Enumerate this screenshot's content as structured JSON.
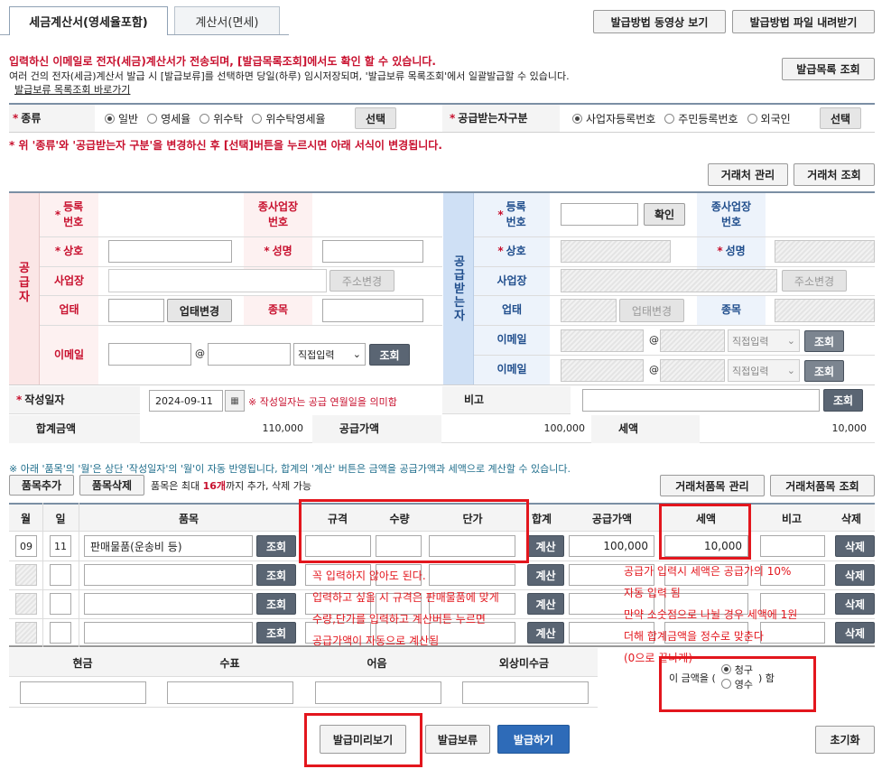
{
  "tabs": [
    {
      "label": "세금계산서(영세율포함)"
    },
    {
      "label": "계산서(면세)"
    }
  ],
  "top_buttons": {
    "video": "발급방법 동영상 보기",
    "download": "발급방법 파일 내려받기",
    "list": "발급목록 조회"
  },
  "notice": {
    "line1": "입력하신 이메일로 전자(세금)계산서가 전송되며, [발급목록조회]에서도 확인 할 수 있습니다.",
    "line2": "여러 건의 전자(세금)계산서 발급 시 [발급보류]를 선택하면 당일(하루) 임시저장되며, '발급보류 목록조회'에서 일괄발급할 수 있습니다.",
    "link": "발급보류 목록조회 바로가기"
  },
  "type_row": {
    "label": "종류",
    "options": [
      "일반",
      "영세율",
      "위수탁",
      "위수탁영세율"
    ],
    "select": "선택",
    "recv_label": "공급받는자구분",
    "recv_options": [
      "사업자등록번호",
      "주민등록번호",
      "외국인"
    ],
    "recv_select": "선택"
  },
  "warning": "* 위 '종류'와 '공급받는자 구분'을 변경하신 후 [선택]버튼을 누르시면 아래 서식이 변경됩니다.",
  "partner_buttons": {
    "manage": "거래처 관리",
    "search": "거래처 조회"
  },
  "supplier": {
    "title": "공급자",
    "reg_no": "등록\n번호",
    "sub_biz": "종사업장\n번호",
    "name": "상호",
    "ceo": "성명",
    "address": "사업장",
    "addr_btn": "주소변경",
    "biz_type": "업태",
    "biz_btn": "업태변경",
    "item": "종목",
    "email": "이메일",
    "at": "@",
    "email_select": "직접입력",
    "search": "조회"
  },
  "receiver": {
    "title": "공급받는자",
    "reg_no": "등록\n번호",
    "confirm": "확인",
    "sub_biz": "종사업장\n번호",
    "name": "상호",
    "ceo": "성명",
    "address": "사업장",
    "addr_btn": "주소변경",
    "biz_type": "업태",
    "biz_btn": "업태변경",
    "item": "종목",
    "email": "이메일",
    "at": "@",
    "email_select": "직접입력",
    "search": "조회"
  },
  "date_row": {
    "label": "작성일자",
    "date": "2024-09-11",
    "note": "※ 작성일자는 공급 연월일을 의미함",
    "remark": "비고",
    "search": "조회"
  },
  "totals": {
    "total_label": "합계금액",
    "total": "110,000",
    "supply_label": "공급가액",
    "supply": "100,000",
    "tax_label": "세액",
    "tax": "10,000"
  },
  "items_notice": "※ 아래 '품목'의 '월'은 상단 '작성일자'의 '월'이 자동 반영됩니다, 합계의 '계산' 버튼은 금액을 공급가액과 세액으로 계산할 수 있습니다.",
  "items_bar": {
    "add": "품목추가",
    "del": "품목삭제",
    "note_pre": "품목은 최대 ",
    "note_max": "16개",
    "note_post": "까지 추가, 삭제 가능",
    "manage": "거래처품목 관리",
    "search": "거래처품목 조회"
  },
  "item_headers": [
    "월",
    "일",
    "품목",
    "규격",
    "수량",
    "단가",
    "합계",
    "공급가액",
    "세액",
    "비고",
    "삭제"
  ],
  "item_rows": [
    {
      "month": "09",
      "day": "11",
      "item": "판매물품(운송비 등)",
      "supply": "100,000",
      "tax": "10,000"
    },
    {
      "month": "",
      "day": "",
      "item": "",
      "supply": "",
      "tax": ""
    },
    {
      "month": "",
      "day": "",
      "item": "",
      "supply": "",
      "tax": ""
    },
    {
      "month": "",
      "day": "",
      "item": "",
      "supply": "",
      "tax": ""
    }
  ],
  "row_buttons": {
    "search": "조회",
    "calc": "계산",
    "delete": "삭제"
  },
  "payment_headers": [
    "현금",
    "수표",
    "어음",
    "외상미수금"
  ],
  "claim": {
    "pre": "이 금액을 (",
    "opt1": "청구",
    "opt2": "영수",
    "post": ") 함"
  },
  "bottom_buttons": {
    "preview": "발급미리보기",
    "hold": "발급보류",
    "issue": "발급하기",
    "reset": "초기화"
  },
  "annotations": {
    "spec": [
      "꼭 입력하지 않아도 된다.",
      "입력하고 싶을 시 규격은 판매물품에 맞게",
      "수량,단가를 입력하고 계산버튼 누르면",
      "공급가액이 자동으로 계산됨"
    ],
    "tax": [
      "공급가 입력시 세액은 공급가의 10%",
      "자동 입력 됨",
      "만약 소숫점으로 나뉠 경우 세액에 1원",
      "더해 합계금액을 정수로 맞춘다",
      "(0으로 끝나게)"
    ]
  },
  "colors": {
    "accent": "#c8102e",
    "supplier_bg": "#fbe6e6",
    "receiver_bg": "#cfe0f5",
    "annotation": "#e3161d",
    "issue_btn": "#2e6bb8"
  }
}
